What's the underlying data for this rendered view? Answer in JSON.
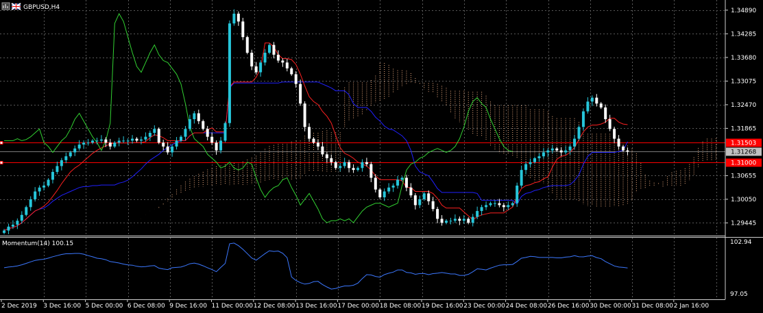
{
  "window": {
    "title": "GBPUSD,H4",
    "icons": [
      "chart-window-icon",
      "uk-flag-icon"
    ]
  },
  "indicator": {
    "label": "Momentum(14) 100.15",
    "scale_top": "102.94",
    "scale_bottom": "97.05"
  },
  "colors": {
    "background": "#000000",
    "grid": "#5a5a5a",
    "bull_candle": "#26c6da",
    "bear_candle": "#ffffff",
    "tenkan": "#ff2020",
    "kijun": "#2020ff",
    "chikou": "#32d232",
    "kumo": "#f4b183",
    "momentum": "#3c78ff",
    "hline": "#ff0000",
    "price_box": "#c0c0c0"
  },
  "price_axis": [
    "1.34890",
    "1.34285",
    "1.33680",
    "1.33075",
    "1.32470",
    "1.31865",
    "1.30655",
    "1.30050",
    "1.29445"
  ],
  "price_tags": [
    {
      "value": "1.31503",
      "kind": "hline"
    },
    {
      "value": "1.31268",
      "kind": "current"
    },
    {
      "value": "1.31000",
      "kind": "hline"
    }
  ],
  "time_axis": [
    "2 Dec 2019",
    "3 Dec 16:00",
    "5 Dec 00:00",
    "6 Dec 08:00",
    "9 Dec 16:00",
    "11 Dec 00:00",
    "12 Dec 08:00",
    "13 Dec 16:00",
    "17 Dec 00:00",
    "18 Dec 08:00",
    "19 Dec 16:00",
    "23 Dec 00:00",
    "24 Dec 08:00",
    "26 Dec 16:00",
    "30 Dec 00:00",
    "31 Dec 08:00",
    "2 Jan 16:00"
  ],
  "chart_data": {
    "type": "candlestick",
    "symbol": "GBPUSD",
    "timeframe": "H4",
    "ylim": [
      1.2912,
      1.3515
    ],
    "close_series": [
      1.2925,
      1.2935,
      1.294,
      1.295,
      1.2965,
      1.2985,
      1.3005,
      1.3025,
      1.3035,
      1.304,
      1.3055,
      1.3075,
      1.309,
      1.3105,
      1.3115,
      1.3125,
      1.3135,
      1.3145,
      1.315,
      1.315,
      1.3155,
      1.3155,
      1.3158,
      1.315,
      1.314,
      1.315,
      1.3155,
      1.3155,
      1.3155,
      1.316,
      1.3155,
      1.3158,
      1.3165,
      1.3175,
      1.3185,
      1.315,
      1.314,
      1.3125,
      1.314,
      1.3155,
      1.3165,
      1.3185,
      1.321,
      1.3225,
      1.3205,
      1.3185,
      1.3165,
      1.315,
      1.313,
      1.3155,
      1.32,
      1.3455,
      1.348,
      1.346,
      1.342,
      1.338,
      1.3345,
      1.333,
      1.3355,
      1.338,
      1.34,
      1.3375,
      1.336,
      1.3355,
      1.334,
      1.3325,
      1.33,
      1.325,
      1.319,
      1.316,
      1.315,
      1.314,
      1.312,
      1.311,
      1.31,
      1.3085,
      1.309,
      1.31,
      1.3085,
      1.308,
      1.3085,
      1.31,
      1.3095,
      1.306,
      1.303,
      1.301,
      1.3025,
      1.3035,
      1.304,
      1.3055,
      1.306,
      1.3035,
      1.3015,
      1.299,
      1.3005,
      1.302,
      1.3,
      1.298,
      1.2955,
      1.2945,
      1.295,
      1.295,
      1.2955,
      1.295,
      1.2955,
      1.2945,
      1.296,
      1.2975,
      1.2985,
      1.299,
      1.2995,
      1.2995,
      1.299,
      1.2985,
      1.299,
      1.2995,
      1.304,
      1.308,
      1.3095,
      1.31,
      1.311,
      1.3115,
      1.3125,
      1.313,
      1.3135,
      1.313,
      1.3125,
      1.313,
      1.314,
      1.316,
      1.319,
      1.323,
      1.3255,
      1.3265,
      1.325,
      1.324,
      1.321,
      1.3185,
      1.316,
      1.314,
      1.313,
      1.3127
    ]
  }
}
